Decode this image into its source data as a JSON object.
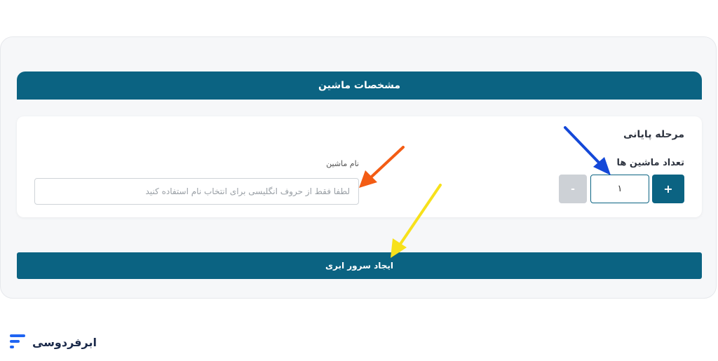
{
  "section": {
    "title": "مشخصات ماشین"
  },
  "machine": {
    "stage_title": "مرحله پایانی",
    "count_label": "تعداد ماشین ها",
    "count_value": "۱",
    "plus_label": "+",
    "minus_label": "-",
    "name_label": "نام ماشین",
    "name_placeholder": "لطفا فقط از حروف انگلیسی برای انتخاب نام استفاده کنید"
  },
  "actions": {
    "create_label": "ایجاد سرور ابری"
  },
  "brand": {
    "name": "ابرفردوسی"
  },
  "colors": {
    "primary": "#0b6382",
    "arrow_blue": "#1448d8",
    "arrow_orange": "#f35c14",
    "arrow_yellow": "#f7e11b",
    "logo_blue": "#1f64f2"
  },
  "icons": [
    "brand-logo-icon",
    "annotation-arrow-icon"
  ]
}
